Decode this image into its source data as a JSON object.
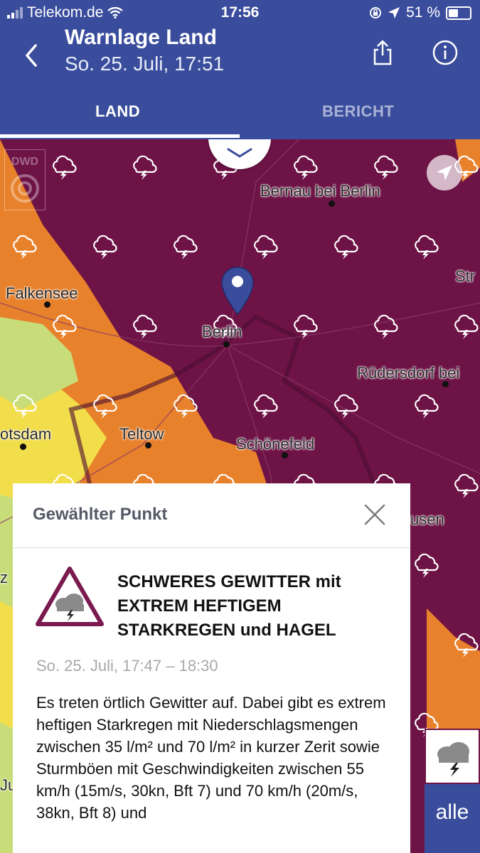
{
  "status_bar": {
    "carrier": "Telekom.de",
    "time": "17:56",
    "battery": "51 %"
  },
  "header": {
    "title": "Warnlage Land",
    "subtitle": "So. 25. Juli, 17:51"
  },
  "tabs": [
    {
      "label": "LAND",
      "active": true
    },
    {
      "label": "BERICHT",
      "active": false
    }
  ],
  "map": {
    "places": [
      "Bernau bei Berlin",
      "Falkensee",
      "Berlin",
      "Rüdersdorf bei",
      "otsdam",
      "Teltow",
      "Schönefeld",
      "usen",
      "Str",
      "Ju",
      "z"
    ],
    "colors": {
      "extreme": "#6e1346",
      "severe": "#e8812b",
      "moderate": "#f2dd4b",
      "minor": "#c8dd7a"
    }
  },
  "popup": {
    "title": "Gewählter Punkt",
    "warning": {
      "headline": "SCHWERES GEWITTER mit EXTREM HEFTIGEM STARKREGEN und HAGEL",
      "time": "So. 25. Juli, 17:47 – 18:30",
      "body": "Es treten örtlich Gewitter auf. Dabei gibt es extrem heftigen Starkregen mit Niederschlagsmengen zwischen 35 l/m² und 70 l/m² in kurzer Zerit sowie Sturmböen mit Geschwindigkeiten zwischen 55 km/h (15m/s, 30kn, Bft 7) und 70 km/h (20m/s, 38kn, Bft 8) und"
    }
  },
  "legend": {
    "button_label": "alle"
  }
}
